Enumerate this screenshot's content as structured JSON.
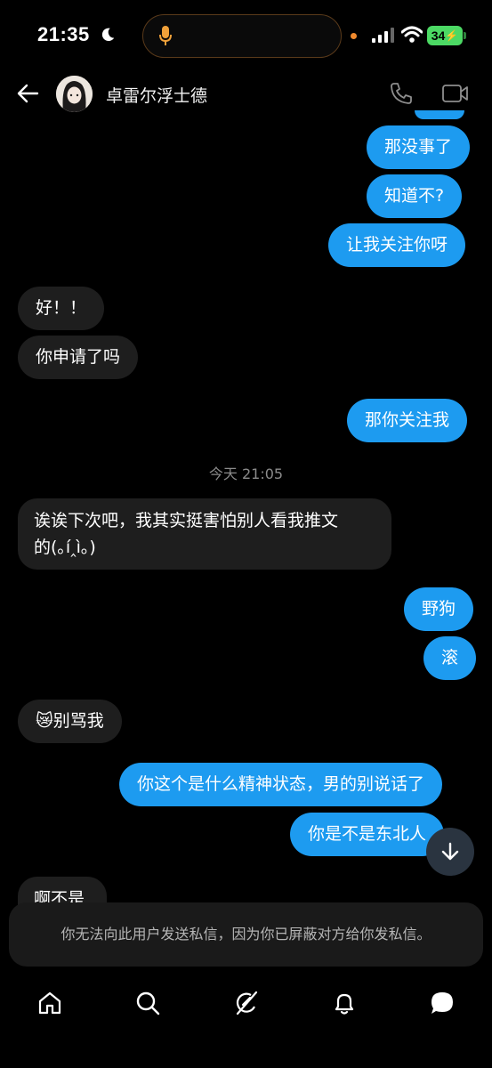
{
  "status": {
    "time": "21:35",
    "battery": "34"
  },
  "header": {
    "name": "卓雷尔浮士德"
  },
  "messages": {
    "m1": "那没事了",
    "m2": "知道不?",
    "m3": "让我关注你呀",
    "m4": "好！！",
    "m5": "你申请了吗",
    "m6": "那你关注我",
    "timestamp": "今天 21:05",
    "m7_line1": "诶诶下次吧，我其实挺害怕别人看我推文",
    "m7_line2": "的(｡í‸ì｡)",
    "m8": "野狗",
    "m9": "滚",
    "m10": "😿别骂我",
    "m11": "你这个是什么精神状态，男的别说话了",
    "m12": "你是不是东北人",
    "m13": "啊不是"
  },
  "notice": "你无法向此用户发送私信，因为你已屏蔽对方给你发私信。",
  "icons": {
    "status": [
      "moon-icon",
      "mic-icon",
      "signal-icon",
      "wifi-icon",
      "battery-icon"
    ],
    "header": [
      "back-arrow-icon",
      "phone-icon",
      "video-icon"
    ],
    "nav": [
      "home-icon",
      "search-icon",
      "grok-icon",
      "bell-icon",
      "messages-icon"
    ]
  },
  "colors": {
    "outgoing": "#1d9bf0",
    "incoming": "#1e1e1e",
    "background": "#000000"
  }
}
